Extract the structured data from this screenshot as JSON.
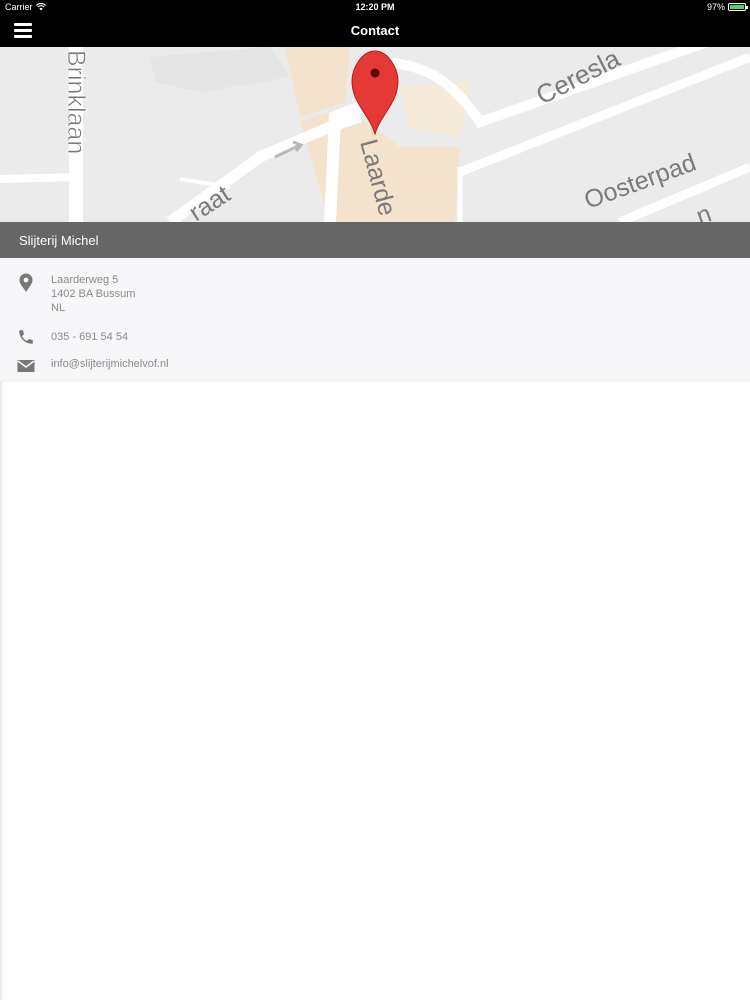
{
  "status_bar": {
    "carrier": "Carrier",
    "time": "12:20 PM",
    "battery": "97%",
    "battery_level": 0.97
  },
  "nav": {
    "title": "Contact",
    "menu_icon": "hamburger-menu-icon"
  },
  "map": {
    "street_labels": [
      "Brinklaan",
      "Ceresla",
      "Laarde",
      "Oosterpad",
      "raat",
      "n"
    ],
    "marker_icon": "map-pin-icon",
    "colors": {
      "background": "#ebebeb",
      "road": "#ffffff",
      "area": "#f3e3cc",
      "marker": "#e53935"
    }
  },
  "contact": {
    "name": "Slijterij Michel",
    "address": [
      "Laarderweg 5",
      "1402 BA Bussum",
      "NL"
    ],
    "phone": "035 - 691 54 54",
    "email": "info@slijterijmichelvof.nl",
    "icons": {
      "address": "location-pin-icon",
      "phone": "phone-icon",
      "email": "envelope-icon"
    }
  },
  "colors": {
    "nav_background": "#000000",
    "name_bar": "#666666",
    "details_background": "#f7f7f9",
    "detail_text": "#8a8a8a"
  }
}
